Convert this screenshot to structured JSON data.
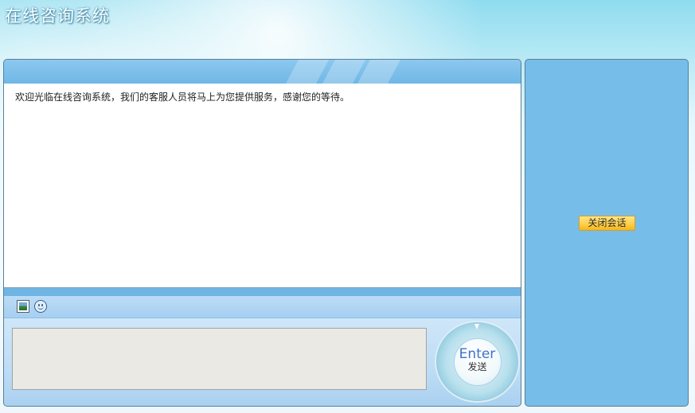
{
  "app": {
    "title": "在线咨询系统"
  },
  "chat": {
    "welcome_message": "欢迎光临在线咨询系统，我们的客服人员将马上为您提供服务，感谢您的等待。",
    "toolbar": {
      "image_icon": "image-icon",
      "emoji_icon": "emoji-icon"
    },
    "input": {
      "value": "",
      "placeholder": ""
    },
    "send": {
      "label": "Enter",
      "sublabel": "发送"
    }
  },
  "side": {
    "close_label": "关闭会话"
  },
  "colors": {
    "panel_blue": "#77bde9",
    "button_yellow": "#ffd04a",
    "send_text_blue": "#3f73c6"
  }
}
